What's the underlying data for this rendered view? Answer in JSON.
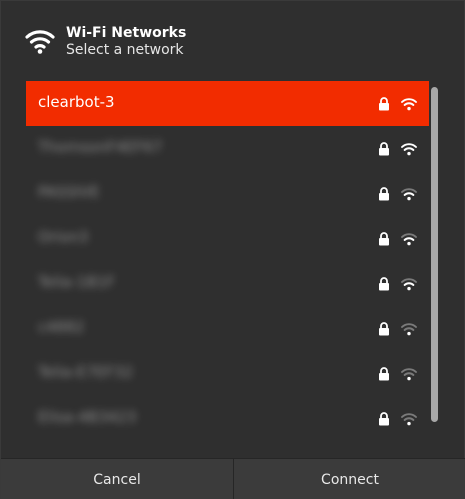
{
  "header": {
    "title": "Wi-Fi Networks",
    "subtitle": "Select a network",
    "icon": "wifi-icon"
  },
  "networks": [
    {
      "name": "clearbot-3",
      "secured": true,
      "selected": true,
      "blurred": false,
      "signal": "strong"
    },
    {
      "name": "ThomsonF4EF67",
      "secured": true,
      "selected": false,
      "blurred": true,
      "signal": "strong"
    },
    {
      "name": "PASSIVE",
      "secured": true,
      "selected": false,
      "blurred": true,
      "signal": "medium"
    },
    {
      "name": "Orion3",
      "secured": true,
      "selected": false,
      "blurred": true,
      "signal": "medium"
    },
    {
      "name": "Telia-1B1F",
      "secured": true,
      "selected": false,
      "blurred": true,
      "signal": "medium"
    },
    {
      "name": "c4882",
      "secured": true,
      "selected": false,
      "blurred": true,
      "signal": "weak"
    },
    {
      "name": "Telia-E7EF32",
      "secured": true,
      "selected": false,
      "blurred": true,
      "signal": "weak"
    },
    {
      "name": "Elisa-4B3423",
      "secured": true,
      "selected": false,
      "blurred": true,
      "signal": "weak"
    }
  ],
  "footer": {
    "cancel_label": "Cancel",
    "connect_label": "Connect"
  },
  "colors": {
    "accent": "#f22c00",
    "background": "#2f2f2f"
  }
}
